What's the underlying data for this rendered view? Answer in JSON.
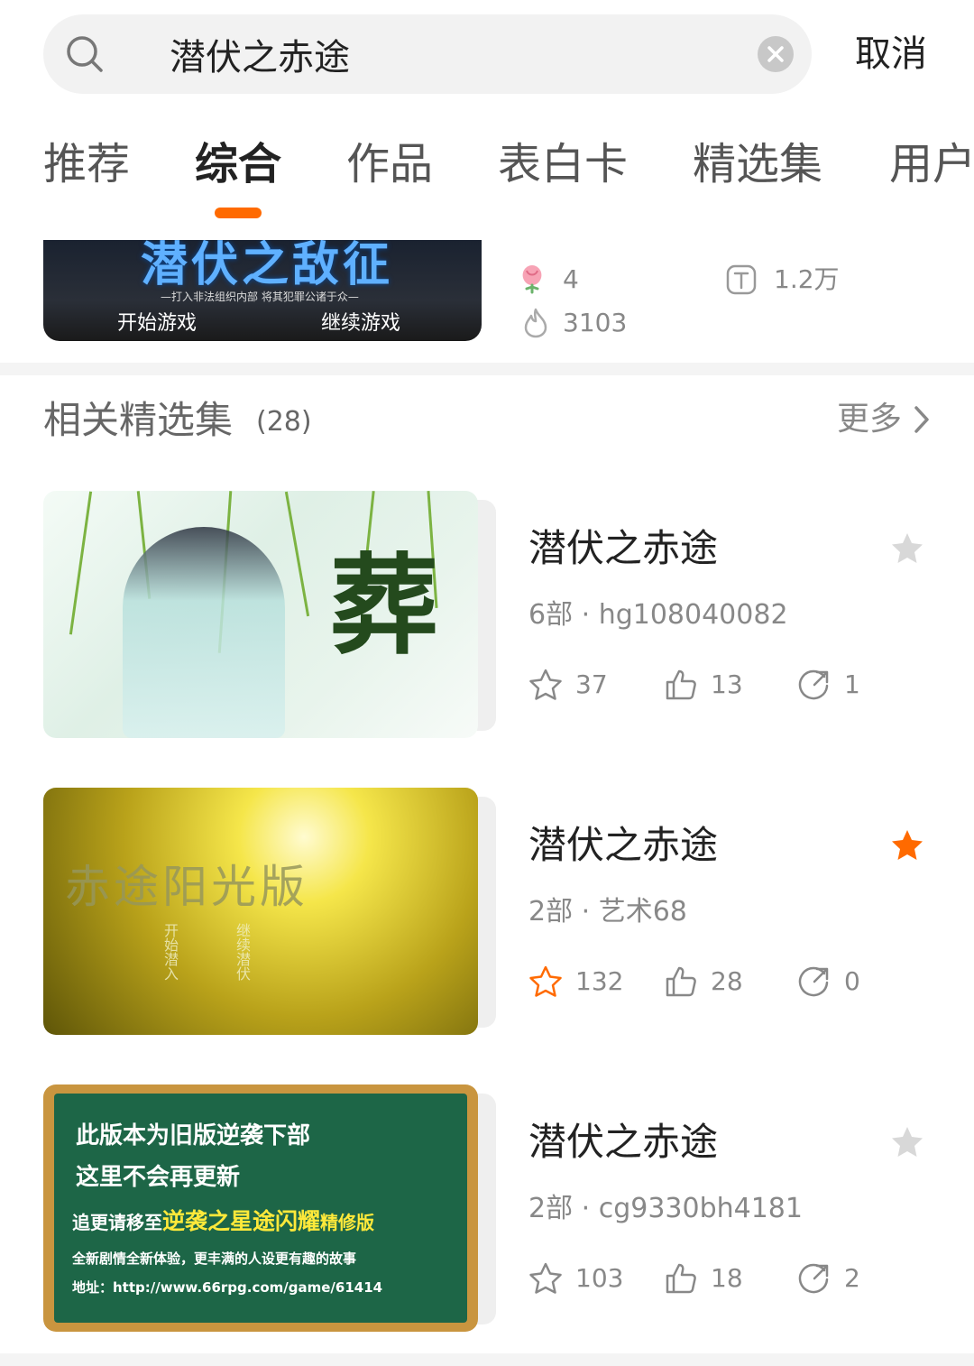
{
  "search": {
    "value": "潜伏之赤途",
    "cancel_label": "取消"
  },
  "tabs": [
    {
      "label": "推荐",
      "active": false
    },
    {
      "label": "综合",
      "active": true
    },
    {
      "label": "作品",
      "active": false
    },
    {
      "label": "表白卡",
      "active": false
    },
    {
      "label": "精选集",
      "active": false
    },
    {
      "label": "用户",
      "active": false
    }
  ],
  "top_result": {
    "cover_title": "潜伏之敌征",
    "cover_subtitle": "—打入非法组织内部 将其犯罪公诸于众—",
    "cover_btn_start": "开始游戏",
    "cover_btn_continue": "继续游戏",
    "flowers": "4",
    "words": "1.2万",
    "heat": "3103"
  },
  "section": {
    "title": "相关精选集",
    "count": "(28)",
    "more_label": "更多"
  },
  "collections": [
    {
      "title": "潜伏之赤途",
      "meta": "6部 · hg108040082",
      "favorited": false,
      "stars": "37",
      "likes": "13",
      "shares": "1",
      "cover_text": "葬"
    },
    {
      "title": "潜伏之赤途",
      "meta": "2部 · 艺术68",
      "favorited": true,
      "stars": "132",
      "likes": "28",
      "shares": "0",
      "cover_text": "赤途阳光版",
      "cover_vertical_a": "开始潜入",
      "cover_vertical_b": "继续潜伏"
    },
    {
      "title": "潜伏之赤途",
      "meta": "2部 · cg9330bh4181",
      "favorited": false,
      "stars": "103",
      "likes": "18",
      "shares": "2",
      "cover_lines": {
        "l1": "此版本为旧版逆袭下部",
        "l2": "这里不会再更新",
        "l3a": "追更请移至",
        "l3b": "逆袭之星途闪耀",
        "l3c": "精修版",
        "l4": "全新剧情全新体验，更丰满的人设更有趣的故事",
        "l5": "地址：http://www.66rpg.com/game/61414"
      }
    }
  ],
  "colors": {
    "accent": "#ff6a00",
    "favorite_star": "#ff6a00",
    "muted_text": "#888888"
  },
  "icons": [
    "search-icon",
    "clear-icon",
    "flower-icon",
    "text-icon",
    "flame-icon",
    "chevron-right-icon",
    "star-outline-icon",
    "thumbs-up-icon",
    "share-icon",
    "star-badge-icon"
  ]
}
